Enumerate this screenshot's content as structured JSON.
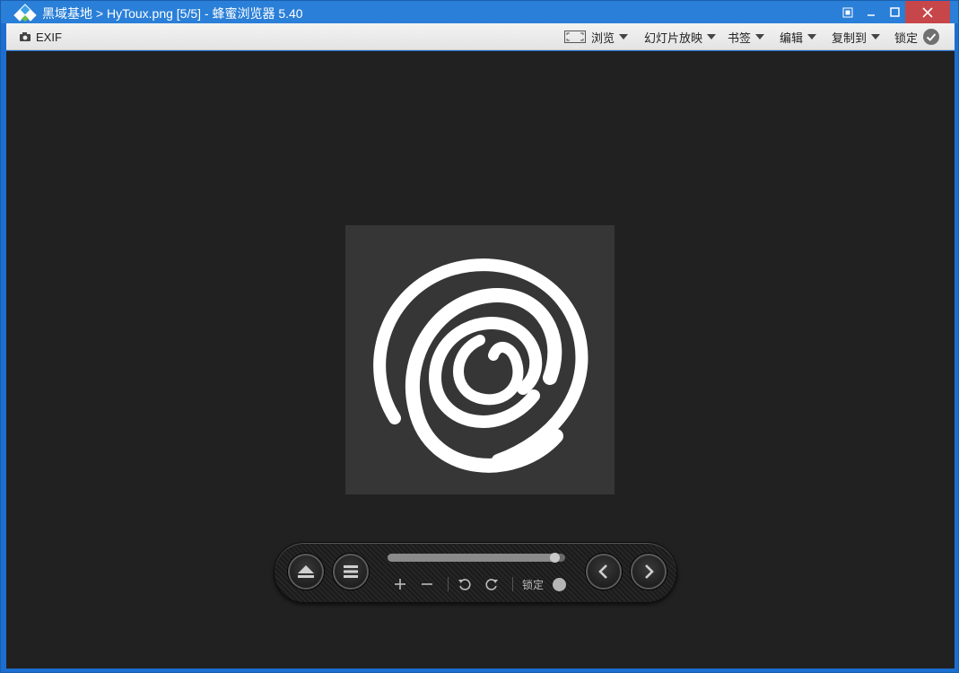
{
  "window": {
    "title": "黑域基地 > HyToux.png [5/5] - 蜂蜜浏览器 5.40"
  },
  "toolbar": {
    "exif_label": "EXIF",
    "browse_label": "浏览",
    "slideshow_label": "幻灯片放映",
    "bookmark_label": "书签",
    "edit_label": "编辑",
    "copy_to_label": "复制到",
    "lock_label": "锁定"
  },
  "controls": {
    "lock_label": "锁定",
    "zoom_slider_fraction": 0.97
  },
  "colors": {
    "titlebar": "#2a7fd8",
    "close_button": "#c7464a",
    "viewer_background": "#212121",
    "image_background": "#363636"
  },
  "icons": {
    "eject": "eject-icon",
    "menu": "menu-icon",
    "previous": "chevron-left-icon",
    "next": "chevron-right-icon",
    "zoom_in": "plus-icon",
    "zoom_out": "minus-icon",
    "rotate_left": "rotate-left-icon",
    "rotate_right": "rotate-right-icon"
  }
}
